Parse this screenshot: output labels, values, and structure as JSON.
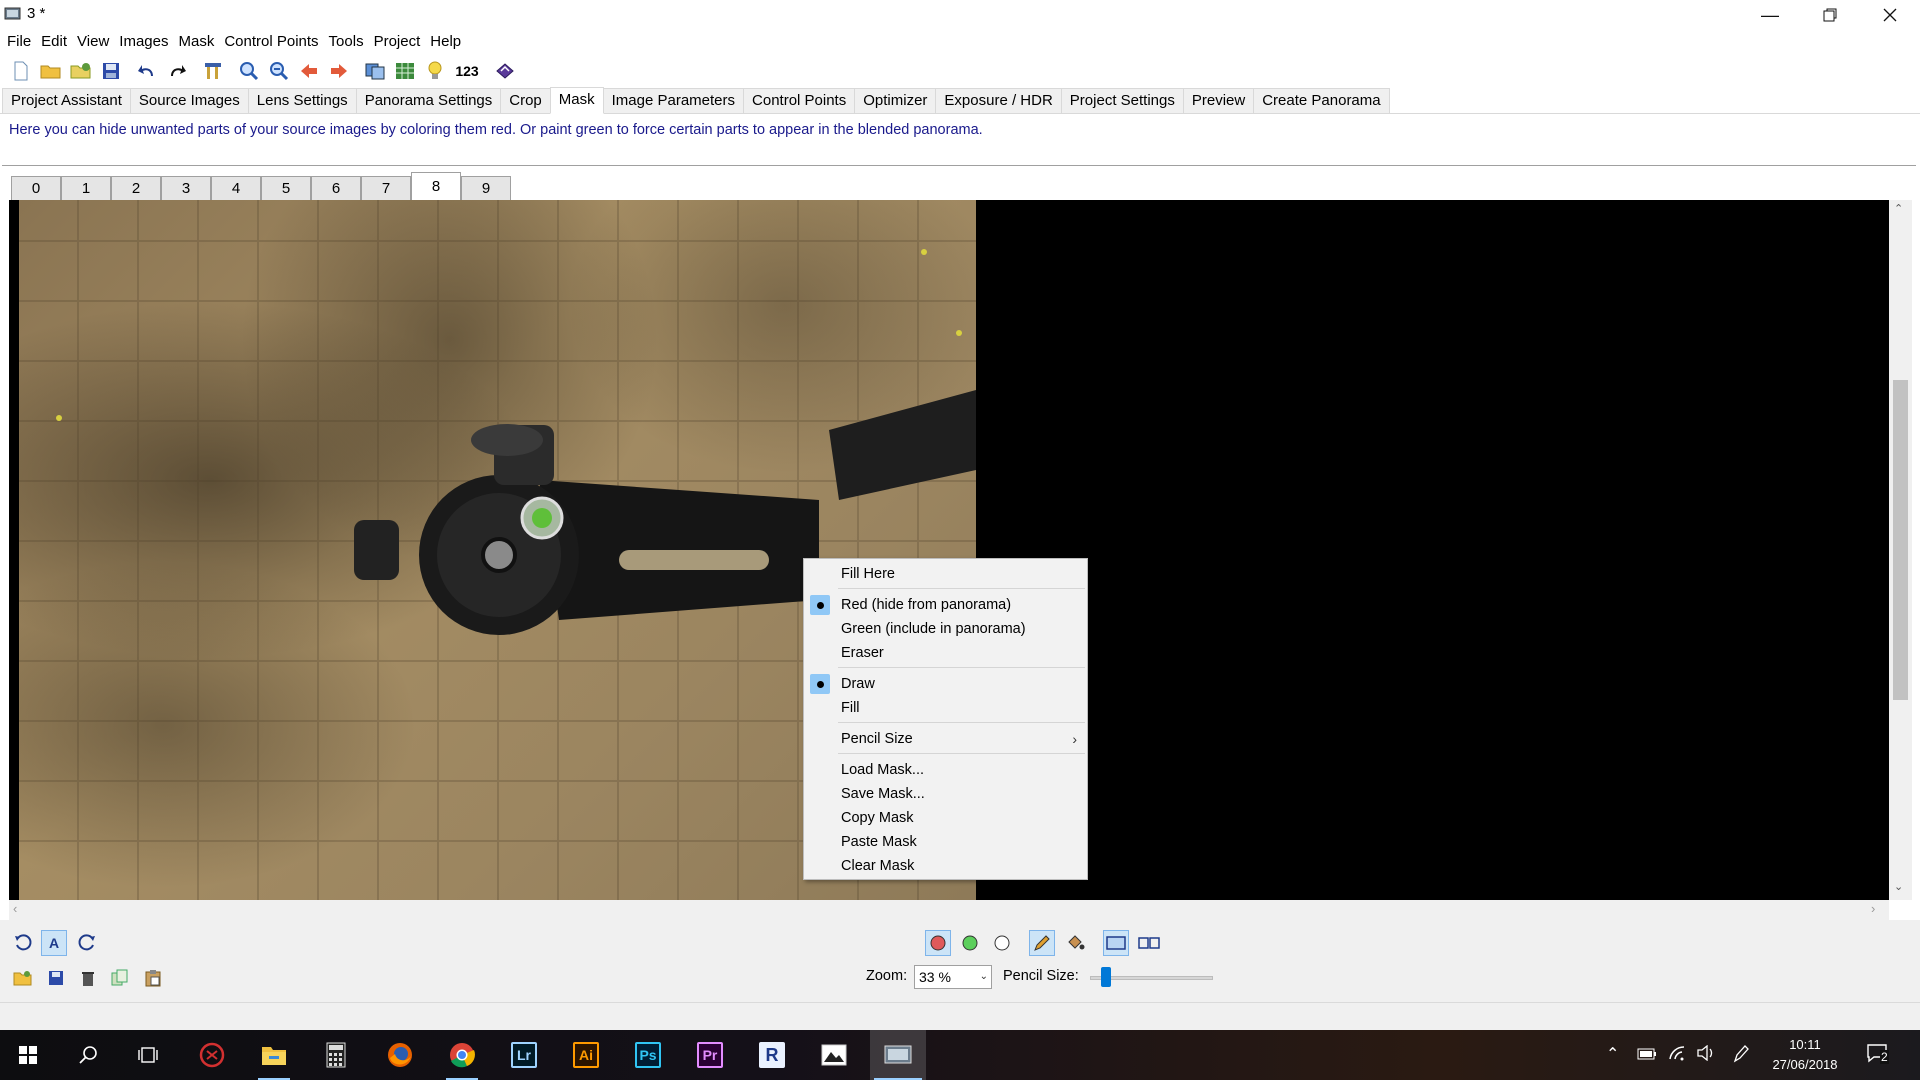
{
  "window": {
    "title": "3 *"
  },
  "menubar": [
    "File",
    "Edit",
    "View",
    "Images",
    "Mask",
    "Control Points",
    "Tools",
    "Project",
    "Help"
  ],
  "toolbar": {
    "number_button": "123"
  },
  "main_tabs": [
    "Project Assistant",
    "Source Images",
    "Lens Settings",
    "Panorama Settings",
    "Crop",
    "Mask",
    "Image Parameters",
    "Control Points",
    "Optimizer",
    "Exposure / HDR",
    "Project Settings",
    "Preview",
    "Create Panorama"
  ],
  "active_main_tab": "Mask",
  "hint": "Here you can hide unwanted parts of your source images by coloring them red. Or paint green to force certain parts to appear in the blended panorama.",
  "image_tabs": [
    "0",
    "1",
    "2",
    "3",
    "4",
    "5",
    "6",
    "7",
    "8",
    "9"
  ],
  "active_image_tab": "8",
  "context_menu": {
    "fill_here": "Fill Here",
    "red": "Red (hide from panorama)",
    "green": "Green (include in panorama)",
    "eraser": "Eraser",
    "draw": "Draw",
    "fill": "Fill",
    "pencil_size": "Pencil Size",
    "load_mask": "Load Mask...",
    "save_mask": "Save Mask...",
    "copy_mask": "Copy Mask",
    "paste_mask": "Paste Mask",
    "clear_mask": "Clear Mask",
    "selected_color": "Red (hide from panorama)",
    "selected_tool": "Draw"
  },
  "bottom": {
    "zoom_label": "Zoom:",
    "zoom_value": "33 %",
    "pencil_size_label": "Pencil Size:",
    "pencil_size_fraction": 0.1
  },
  "taskbar": {
    "apps": [
      "Lr",
      "Ai",
      "Ps",
      "Pr",
      "R"
    ],
    "time": "10:11",
    "date": "27/06/2018",
    "notification_count": "2"
  },
  "colors": {
    "accent": "#0078d7",
    "menu_highlight": "#90c8f6",
    "hint_text": "#1a1a8c"
  }
}
